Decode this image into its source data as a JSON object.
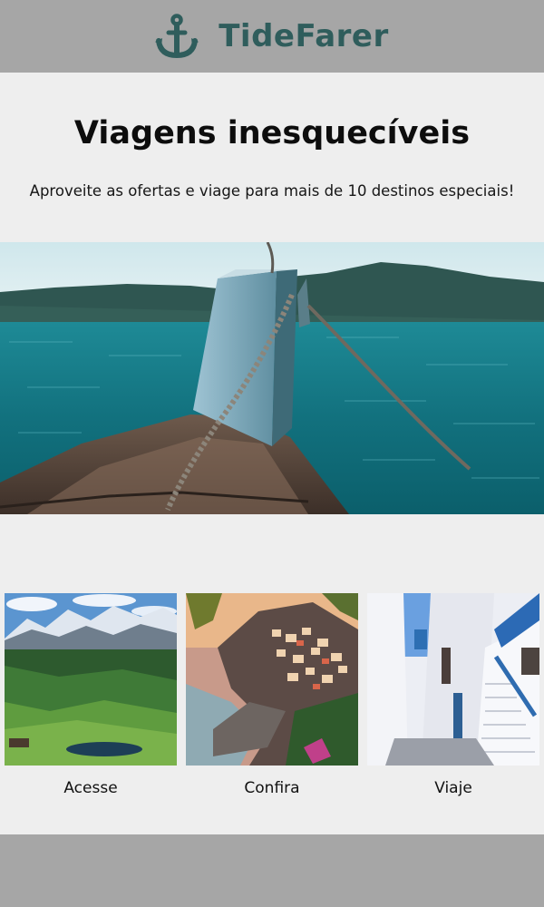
{
  "header": {
    "brand": "TideFarer",
    "logo_icon": "anchor-icon",
    "brand_color": "#2f5d5c"
  },
  "intro": {
    "title": "Viagens inesquecíveis",
    "subtitle": "Aproveite as ofertas e viage para mais de 10 destinos especiais!"
  },
  "cards": [
    {
      "label": "Acesse"
    },
    {
      "label": "Confira"
    },
    {
      "label": "Viaje"
    }
  ],
  "colors": {
    "bar": "#a6a6a6",
    "background": "#eeeeee"
  }
}
